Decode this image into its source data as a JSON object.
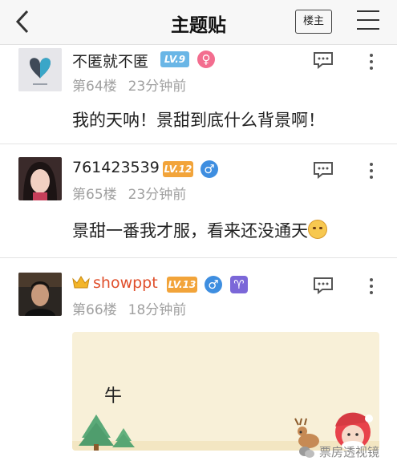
{
  "header": {
    "title": "主题贴",
    "owner_only_label": "楼主"
  },
  "posts": [
    {
      "username": "不匿就不匿",
      "level": "LV.9",
      "gender": "♀",
      "floor": "第64楼",
      "time": "23分钟前",
      "content": "我的天呐！景甜到底什么背景啊！"
    },
    {
      "username": "761423539",
      "level": "LV.12",
      "gender": "♂",
      "floor": "第65楼",
      "time": "23分钟前",
      "content": "景甜一番我才服，看来还没通天"
    },
    {
      "username": "showppt",
      "level": "LV.13",
      "gender": "♂",
      "zodiac": "♈",
      "floor": "第66楼",
      "time": "18分钟前",
      "content": "牛"
    }
  ],
  "watermark": "票房透视镜",
  "colors": {
    "vip_name": "#e0502d",
    "level_blue": "#6ab6e6",
    "level_orange": "#f2a43a",
    "female": "#f36d8f",
    "male": "#3e8ee0",
    "zodiac": "#7b67d8"
  }
}
